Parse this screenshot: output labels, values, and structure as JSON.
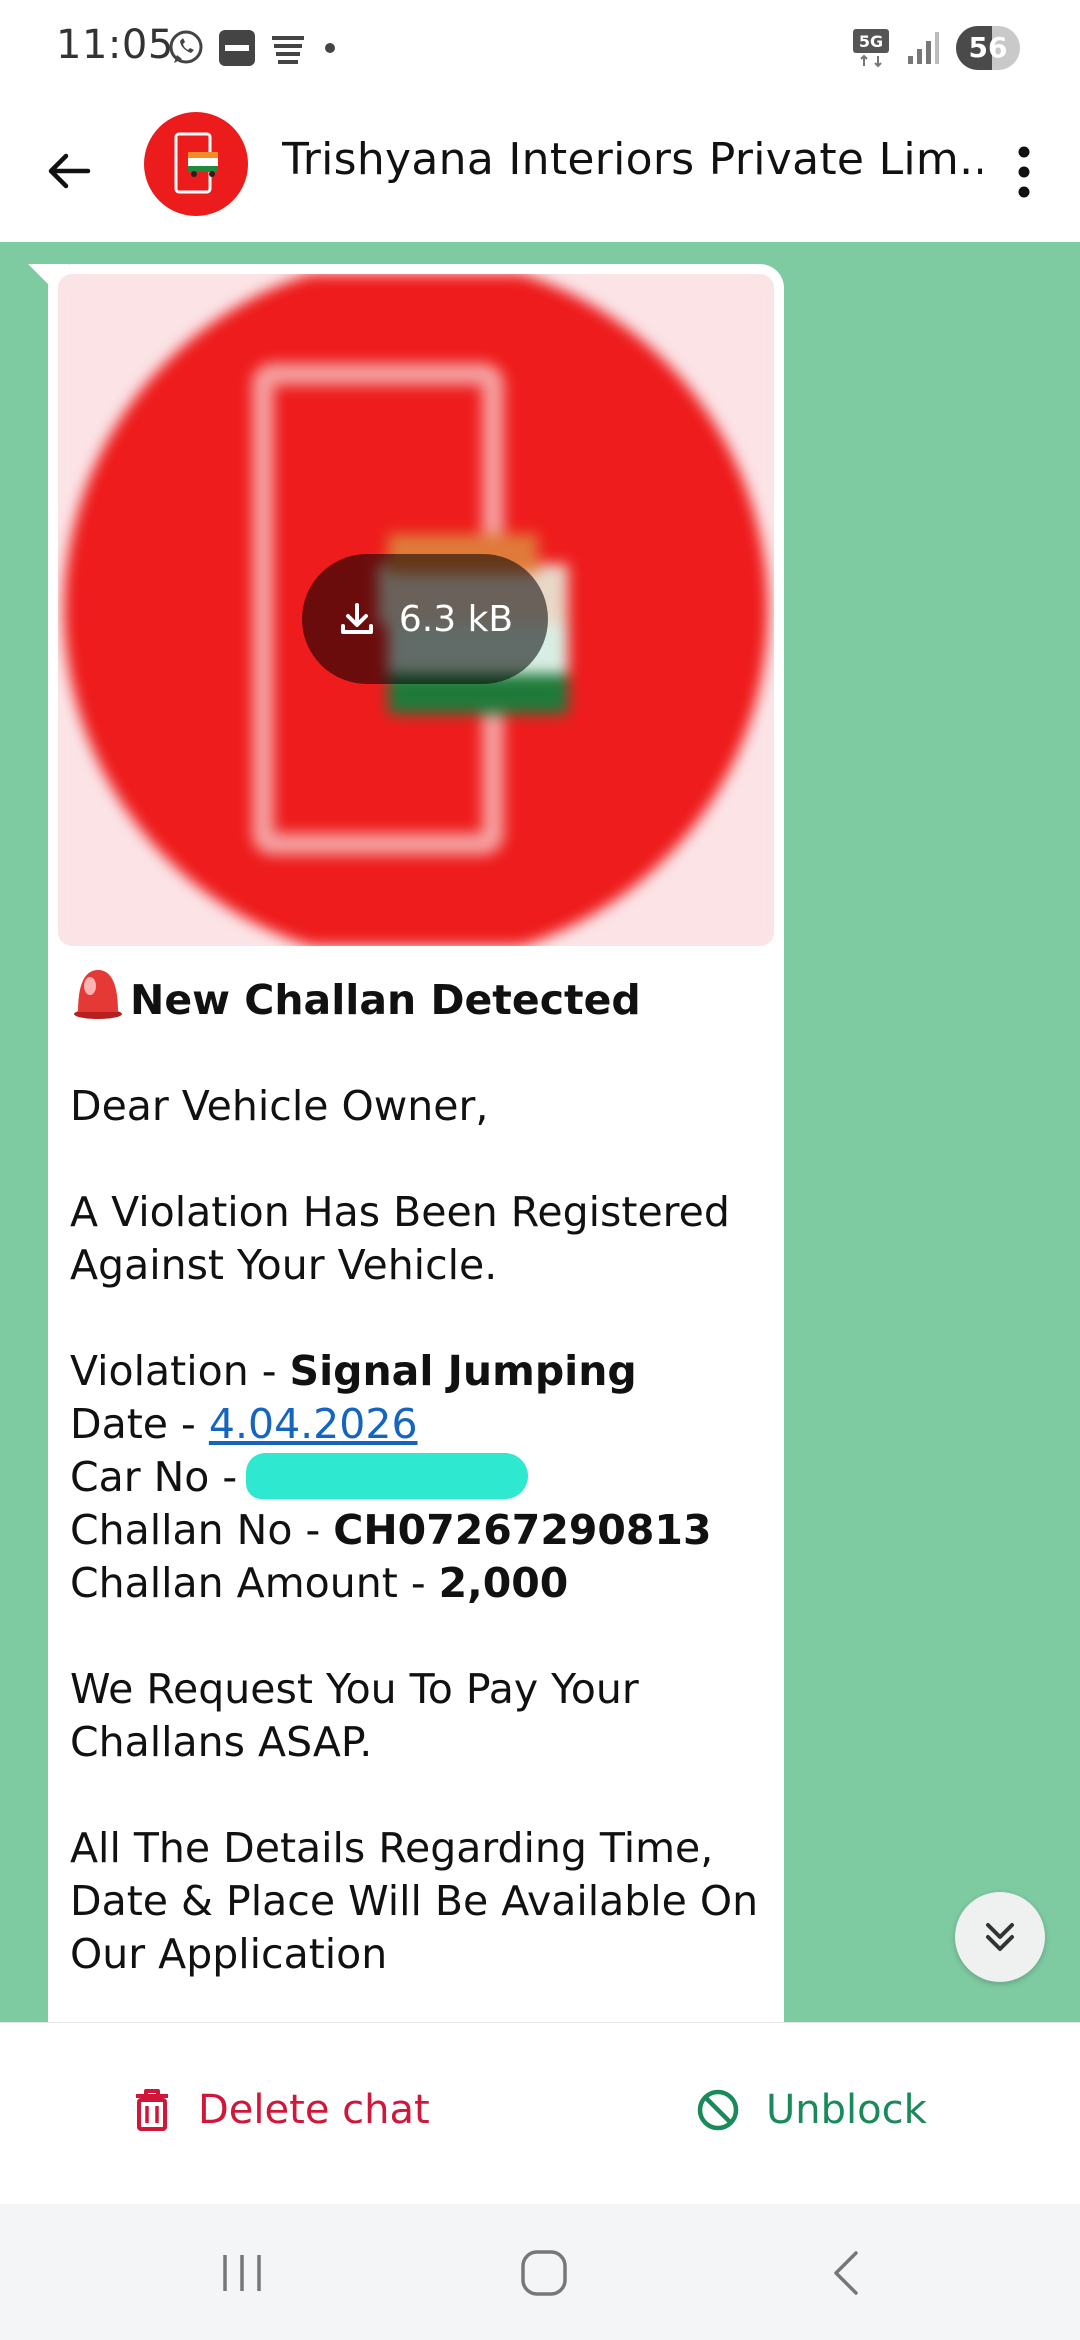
{
  "status_bar": {
    "time": "11:05",
    "left_icons": [
      "whatsapp-icon",
      "paytm-icon",
      "dainik-bhaskar-icon",
      "dot-icon"
    ],
    "network": "5G",
    "battery": "56"
  },
  "header": {
    "title": "Trishyana Interiors Private Lim...",
    "avatar_color": "#ec1c1c"
  },
  "message": {
    "attachment_size": "6.3 kB",
    "heading": "New Challan Detected",
    "greeting": "Dear Vehicle Owner,",
    "intro_1": "A Violation Has Been Registered",
    "intro_2": "Against Your Vehicle.",
    "violation_label": "Violation - ",
    "violation_value": "Signal Jumping",
    "date_label": "Date - ",
    "date_value": "4.04.2026",
    "car_label": "Car No - ",
    "challan_no_label": "Challan No - ",
    "challan_no_value": "CH07267290813",
    "amount_label": "Challan Amount - ",
    "amount_value": "2,000",
    "request_1": "We Request You To Pay Your",
    "request_2": "Challans ASAP.",
    "details_1": "All The Details Regarding Time,",
    "details_2": "Date & Place Will Be Available On",
    "details_3": "Our Application"
  },
  "actions": {
    "delete_label": "Delete chat",
    "unblock_label": "Unblock"
  },
  "colors": {
    "chat_bg": "#7ecaa1",
    "delete": "#d0173a",
    "unblock": "#1a8a5a",
    "link": "#1565c0",
    "redaction": "#2ee8d0"
  }
}
